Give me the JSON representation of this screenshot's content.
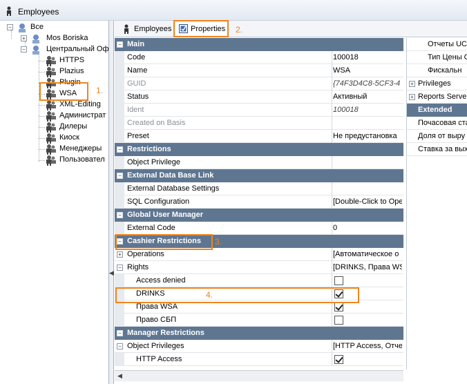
{
  "window": {
    "title": "Employees"
  },
  "tree": {
    "root": "Все",
    "group1": "Mos Boriska",
    "group2": "Центральный Оф",
    "items": [
      "HTTPS",
      "Plazius",
      "Plugin",
      "WSA",
      "XML-Editing",
      "Администрат",
      "Дилеры",
      "Киоск",
      "Менеджеры",
      "Пользовател"
    ]
  },
  "tabs": {
    "employees": "Employees",
    "properties": "Properties"
  },
  "grid": {
    "main": {
      "header": "Main",
      "code_label": "Code",
      "code_value": "100018",
      "name_label": "Name",
      "name_value": "WSA",
      "guid_label": "GUID",
      "guid_value": "{74F3D4C8-5CF3-4",
      "status_label": "Status",
      "status_value": "Активный",
      "ident_label": "Ident",
      "ident_value": "100018",
      "created_label": "Created on Basis",
      "preset_label": "Preset",
      "preset_value": "Не предустановка"
    },
    "restrictions": {
      "header": "Restrictions",
      "object_privilege": "Object Privilege"
    },
    "external_db": {
      "header": "External Data Base Link",
      "settings": "External Database Settings",
      "sql_label": "SQL Configuration",
      "sql_value": "[Double-Click to Ope"
    },
    "global_user": {
      "header": "Global User Manager",
      "ext_code_label": "External Code",
      "ext_code_value": "0"
    },
    "cashier": {
      "header": "Cashier Restrictions",
      "operations_label": "Operations",
      "operations_value": "[Автоматическое о",
      "rights_label": "Rights",
      "rights_value": "[DRINKS, Права WS",
      "access_denied": "Access denied",
      "drinks": "DRINKS",
      "prava_wsa": "Права WSA",
      "prava_sbp": "Право СБП",
      "checks": {
        "access_denied": false,
        "drinks": true,
        "prava_wsa": true,
        "prava_sbp": false
      }
    },
    "manager": {
      "header": "Manager Restrictions",
      "object_privileges_label": "Object Privileges",
      "object_privileges_value": "[HTTP Access, Отче",
      "http_access": "HTTP Access",
      "http_access_checked": true
    }
  },
  "right_pane": {
    "rows": [
      "Отчеты UCS",
      "Тип Цены О",
      "Фискальн",
      "Privileges",
      "Reports Server"
    ],
    "extended_header": "Extended",
    "extended_rows": [
      "Почасовая ста",
      "Доля от выру",
      "Ставка за вых"
    ]
  },
  "annotations": {
    "a1": "1.",
    "a2": "2.",
    "a3": "3.",
    "a4": "4."
  }
}
